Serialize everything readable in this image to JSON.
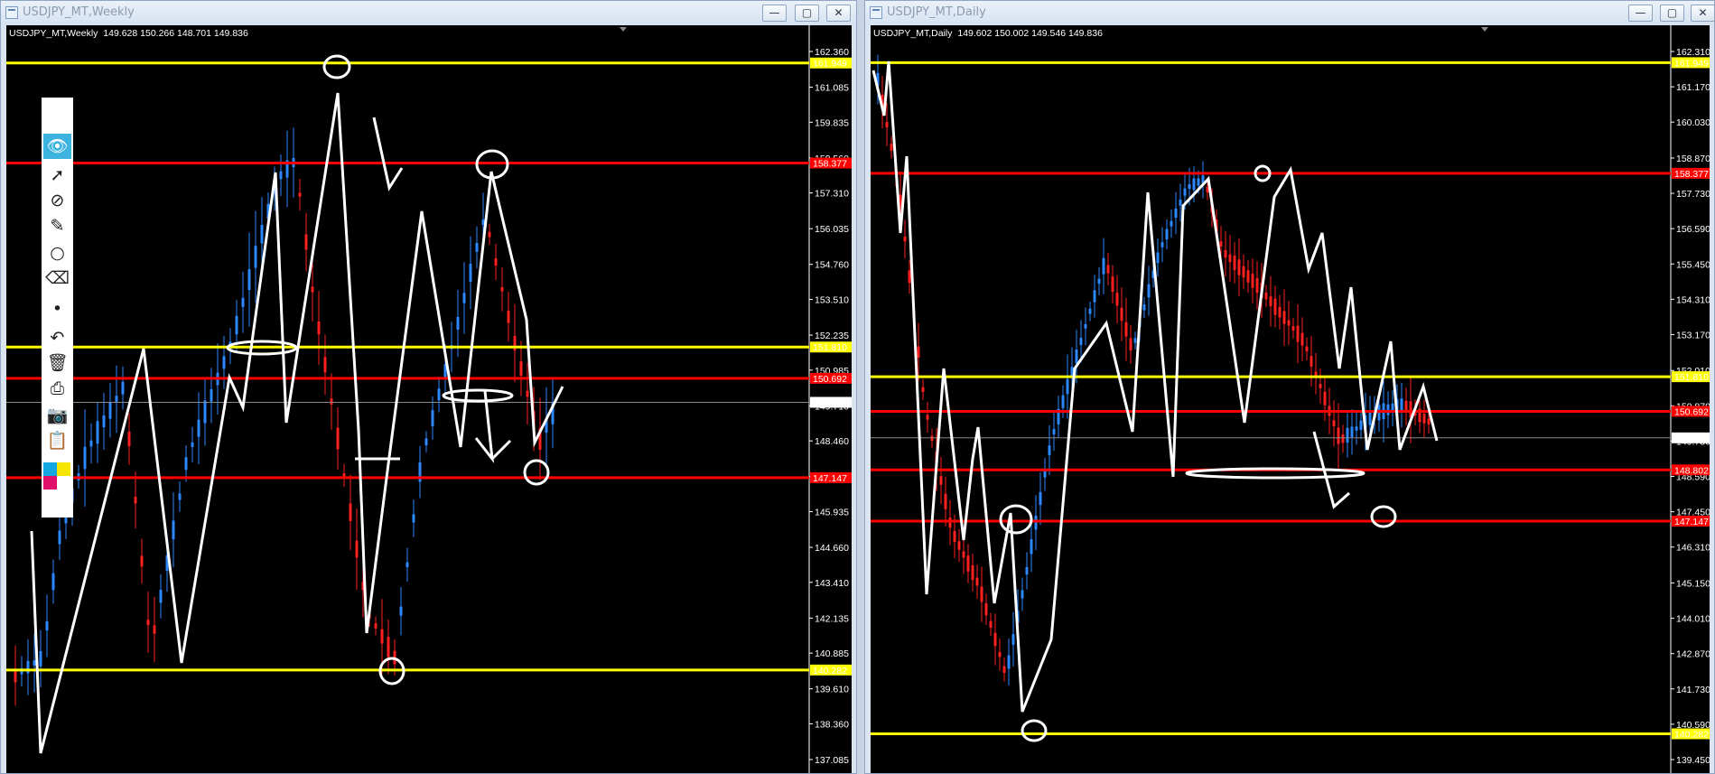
{
  "windows": [
    {
      "title": "USDJPY_MT,Weekly",
      "header": {
        "symbol": "USDJPY_MT,Weekly",
        "ohlc": "149.628 150.266 148.701 149.836"
      },
      "axis_prices": [
        "162.360",
        "161.085",
        "159.835",
        "158.560",
        "157.310",
        "156.035",
        "154.760",
        "153.510",
        "152.235",
        "150.985",
        "149.710",
        "148.460",
        "147.185",
        "145.935",
        "144.660",
        "143.410",
        "142.135",
        "140.885",
        "139.610",
        "138.360",
        "137.085"
      ],
      "levels": [
        {
          "price": "161.949",
          "color": "yellow"
        },
        {
          "price": "158.377",
          "color": "red"
        },
        {
          "price": "151.810",
          "color": "yellow"
        },
        {
          "price": "150.692",
          "color": "red"
        },
        {
          "price": "147.147",
          "color": "red"
        },
        {
          "price": "140.282",
          "color": "yellow"
        }
      ],
      "current_price": "149.836"
    },
    {
      "title": "USDJPY_MT,Daily",
      "header": {
        "symbol": "USDJPY_MT,Daily",
        "ohlc": "149.602 150.002 149.546 149.836"
      },
      "axis_prices": [
        "162.310",
        "161.170",
        "160.030",
        "158.870",
        "157.730",
        "156.590",
        "155.450",
        "154.310",
        "153.170",
        "152.010",
        "150.870",
        "149.730",
        "148.590",
        "147.450",
        "146.310",
        "145.150",
        "144.010",
        "142.870",
        "141.730",
        "140.590",
        "139.450"
      ],
      "levels": [
        {
          "price": "161.949",
          "color": "yellow"
        },
        {
          "price": "158.377",
          "color": "red"
        },
        {
          "price": "151.810",
          "color": "yellow"
        },
        {
          "price": "150.692",
          "color": "red"
        },
        {
          "price": "148.802",
          "color": "red"
        },
        {
          "price": "147.147",
          "color": "red"
        },
        {
          "price": "140.282",
          "color": "yellow"
        }
      ],
      "current_price": "149.836"
    }
  ],
  "window_buttons": {
    "minimize": "—",
    "maximize": "▢",
    "close": "✕"
  },
  "toolbar": {
    "items": [
      "pen-icon",
      "eye-icon",
      "cursor-icon",
      "lasso-icon",
      "highlighter-icon",
      "circle-icon",
      "eraser-icon",
      "dot-icon",
      "undo-icon",
      "trash-icon",
      "stamp-icon",
      "camera-icon",
      "clipboard-icon"
    ],
    "swatches": [
      "#13a6e3",
      "#f5e500",
      "#e0106a",
      "#ffffff"
    ]
  },
  "colors": {
    "yellow": "#ffff00",
    "red": "#ff0000",
    "bull": "#2d88ff",
    "bear": "#ff2020",
    "background": "#000000"
  }
}
